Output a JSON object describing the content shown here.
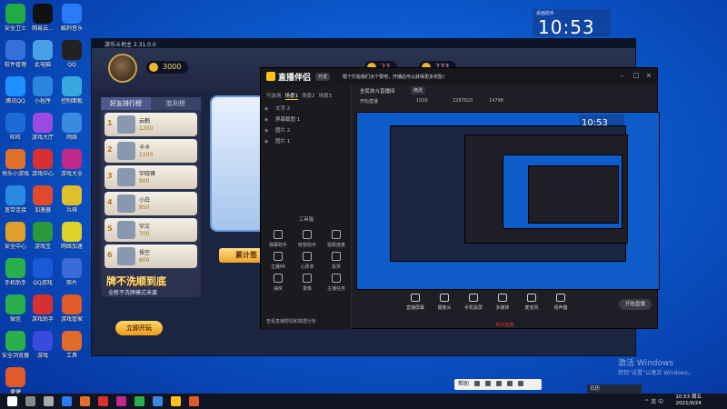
{
  "desktop": {
    "icons": [
      {
        "label": "安全卫士",
        "color": "#22aa44"
      },
      {
        "label": "网易云...",
        "color": "#111111"
      },
      {
        "label": "酷狗音乐",
        "color": "#2a7bf5"
      },
      {
        "label": "软件管理",
        "color": "#3570d8"
      },
      {
        "label": "此电脑",
        "color": "#4aa0e6"
      },
      {
        "label": "QQ",
        "color": "#222222"
      },
      {
        "label": "腾讯QQ",
        "color": "#1e90ff"
      },
      {
        "label": "小程序",
        "color": "#2b86e0"
      },
      {
        "label": "控制面板",
        "color": "#3aa8e0"
      },
      {
        "label": "旺旺",
        "color": "#1a6ad8"
      },
      {
        "label": "游戏大厅",
        "color": "#9a4ae0"
      },
      {
        "label": "网络",
        "color": "#3a8ae0"
      },
      {
        "label": "快乐小游戏",
        "color": "#e0702a"
      },
      {
        "label": "游戏中心",
        "color": "#d83030"
      },
      {
        "label": "游戏大全",
        "color": "#c02a8a"
      },
      {
        "label": "宽带连接",
        "color": "#2a8ae0"
      },
      {
        "label": "加速器",
        "color": "#e04a2a"
      },
      {
        "label": "兵棋",
        "color": "#e0c02a"
      },
      {
        "label": "安全中心",
        "color": "#e0a02a"
      },
      {
        "label": "游戏宝",
        "color": "#2a9a3a"
      },
      {
        "label": "网络加速",
        "color": "#e0d02a"
      },
      {
        "label": "手机助手",
        "color": "#2ab04a"
      },
      {
        "label": "QQ游戏",
        "color": "#1a5ad8"
      },
      {
        "label": "照片",
        "color": "#3a6ad8"
      },
      {
        "label": "微信",
        "color": "#2ab04a"
      },
      {
        "label": "游戏助手",
        "color": "#d83030"
      },
      {
        "label": "游戏管家",
        "color": "#e05a2a"
      },
      {
        "label": "安全浏览器",
        "color": "#2ab04a"
      },
      {
        "label": "游戏",
        "color": "#3a4ae0"
      },
      {
        "label": "工具",
        "color": "#e06a2a"
      },
      {
        "label": "便捷",
        "color": "#e05a2a"
      }
    ]
  },
  "widget_clock": {
    "time": "10:53",
    "label": "桌面助手"
  },
  "game": {
    "title": "游乐斗地主 2.31.0.0",
    "coins": "3000",
    "top_val_1": "23",
    "top_val_2": "233",
    "tabs": [
      "好友排行榜",
      "胜利榜"
    ],
    "friends": [
      {
        "rank": "1",
        "name": "云鹤",
        "value": "1200"
      },
      {
        "rank": "2",
        "name": "卡卡",
        "value": "1100"
      },
      {
        "rank": "3",
        "name": "宇晓锋",
        "value": "900"
      },
      {
        "rank": "4",
        "name": "小白",
        "value": "850"
      },
      {
        "rank": "5",
        "name": "宇文",
        "value": "700"
      },
      {
        "rank": "6",
        "name": "悟空",
        "value": "600"
      }
    ],
    "cumulative": "累计签",
    "promo_title": "牌不洗顺到底",
    "promo_sub": "全新不洗牌模式来袭",
    "promo_btn": "立即开玩"
  },
  "stream": {
    "app_name": "直播伴侣",
    "badge": "开发",
    "notice": "帮个忙给我们点个赞吧，开播后可以获得更多奖励！",
    "scene_tabs": [
      "可选场",
      "场景1",
      "场景2",
      "场景3"
    ],
    "scenes": [
      "文字 2",
      "屏幕截图 1",
      "图片 2",
      "图片 1"
    ],
    "tools_title": "工具箱",
    "tools": [
      {
        "label": "弹幕助手"
      },
      {
        "label": "房管助手"
      },
      {
        "label": "视频连麦"
      },
      {
        "label": "主播PK"
      },
      {
        "label": "心愿单"
      },
      {
        "label": "投票"
      },
      {
        "label": "抽奖"
      },
      {
        "label": "录像"
      },
      {
        "label": "主播任务"
      }
    ],
    "room_name": "全民炫斗直播间",
    "edit": "修改",
    "info": [
      "开始直播",
      "1000",
      "2287820",
      "14798"
    ],
    "controls": [
      "直播屏幕",
      "摄像头",
      "手机投屏",
      "多媒体",
      "麦克风",
      "扬声器"
    ],
    "go_live": "开始直播",
    "footer": "新手指南",
    "bottom_tip": "查看直播帮助和数据分析"
  },
  "nested_clock": "10:53",
  "activation": {
    "line1": "激活 Windows",
    "line2": "转到“设置”以激活 Windows。"
  },
  "float_bar": {
    "label": "帮助"
  },
  "tray_popup": "日历",
  "taskbar": {
    "time": "10:53 周五",
    "date": "2021/9/24",
    "tray": "^ 英 中"
  }
}
